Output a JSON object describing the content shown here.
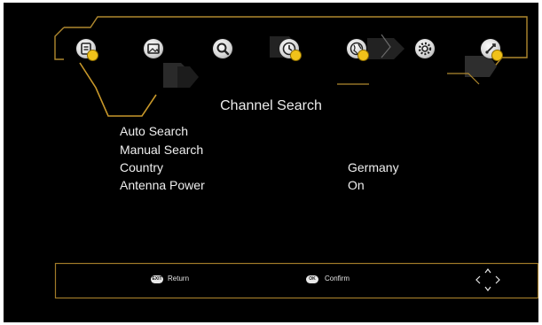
{
  "top_menu": {
    "icons": [
      {
        "name": "info-icon"
      },
      {
        "name": "picture-icon"
      },
      {
        "name": "search-icon"
      },
      {
        "name": "clock-icon"
      },
      {
        "name": "globe-icon"
      },
      {
        "name": "gear-icon"
      },
      {
        "name": "usb-icon"
      }
    ],
    "selected_index": 2,
    "accent_color": "#c8982a"
  },
  "page": {
    "title": "Channel Search"
  },
  "menu": {
    "items": [
      {
        "label": "Auto Search",
        "value": ""
      },
      {
        "label": "Manual Search",
        "value": ""
      },
      {
        "label": "Country",
        "value": "Germany"
      },
      {
        "label": "Antenna Power",
        "value": "On"
      }
    ]
  },
  "footer": {
    "return_key": "EXIT",
    "return_label": "Return",
    "confirm_key": "OK",
    "confirm_label": "Confirm",
    "nav_icon": "arrow-keys-icon"
  }
}
